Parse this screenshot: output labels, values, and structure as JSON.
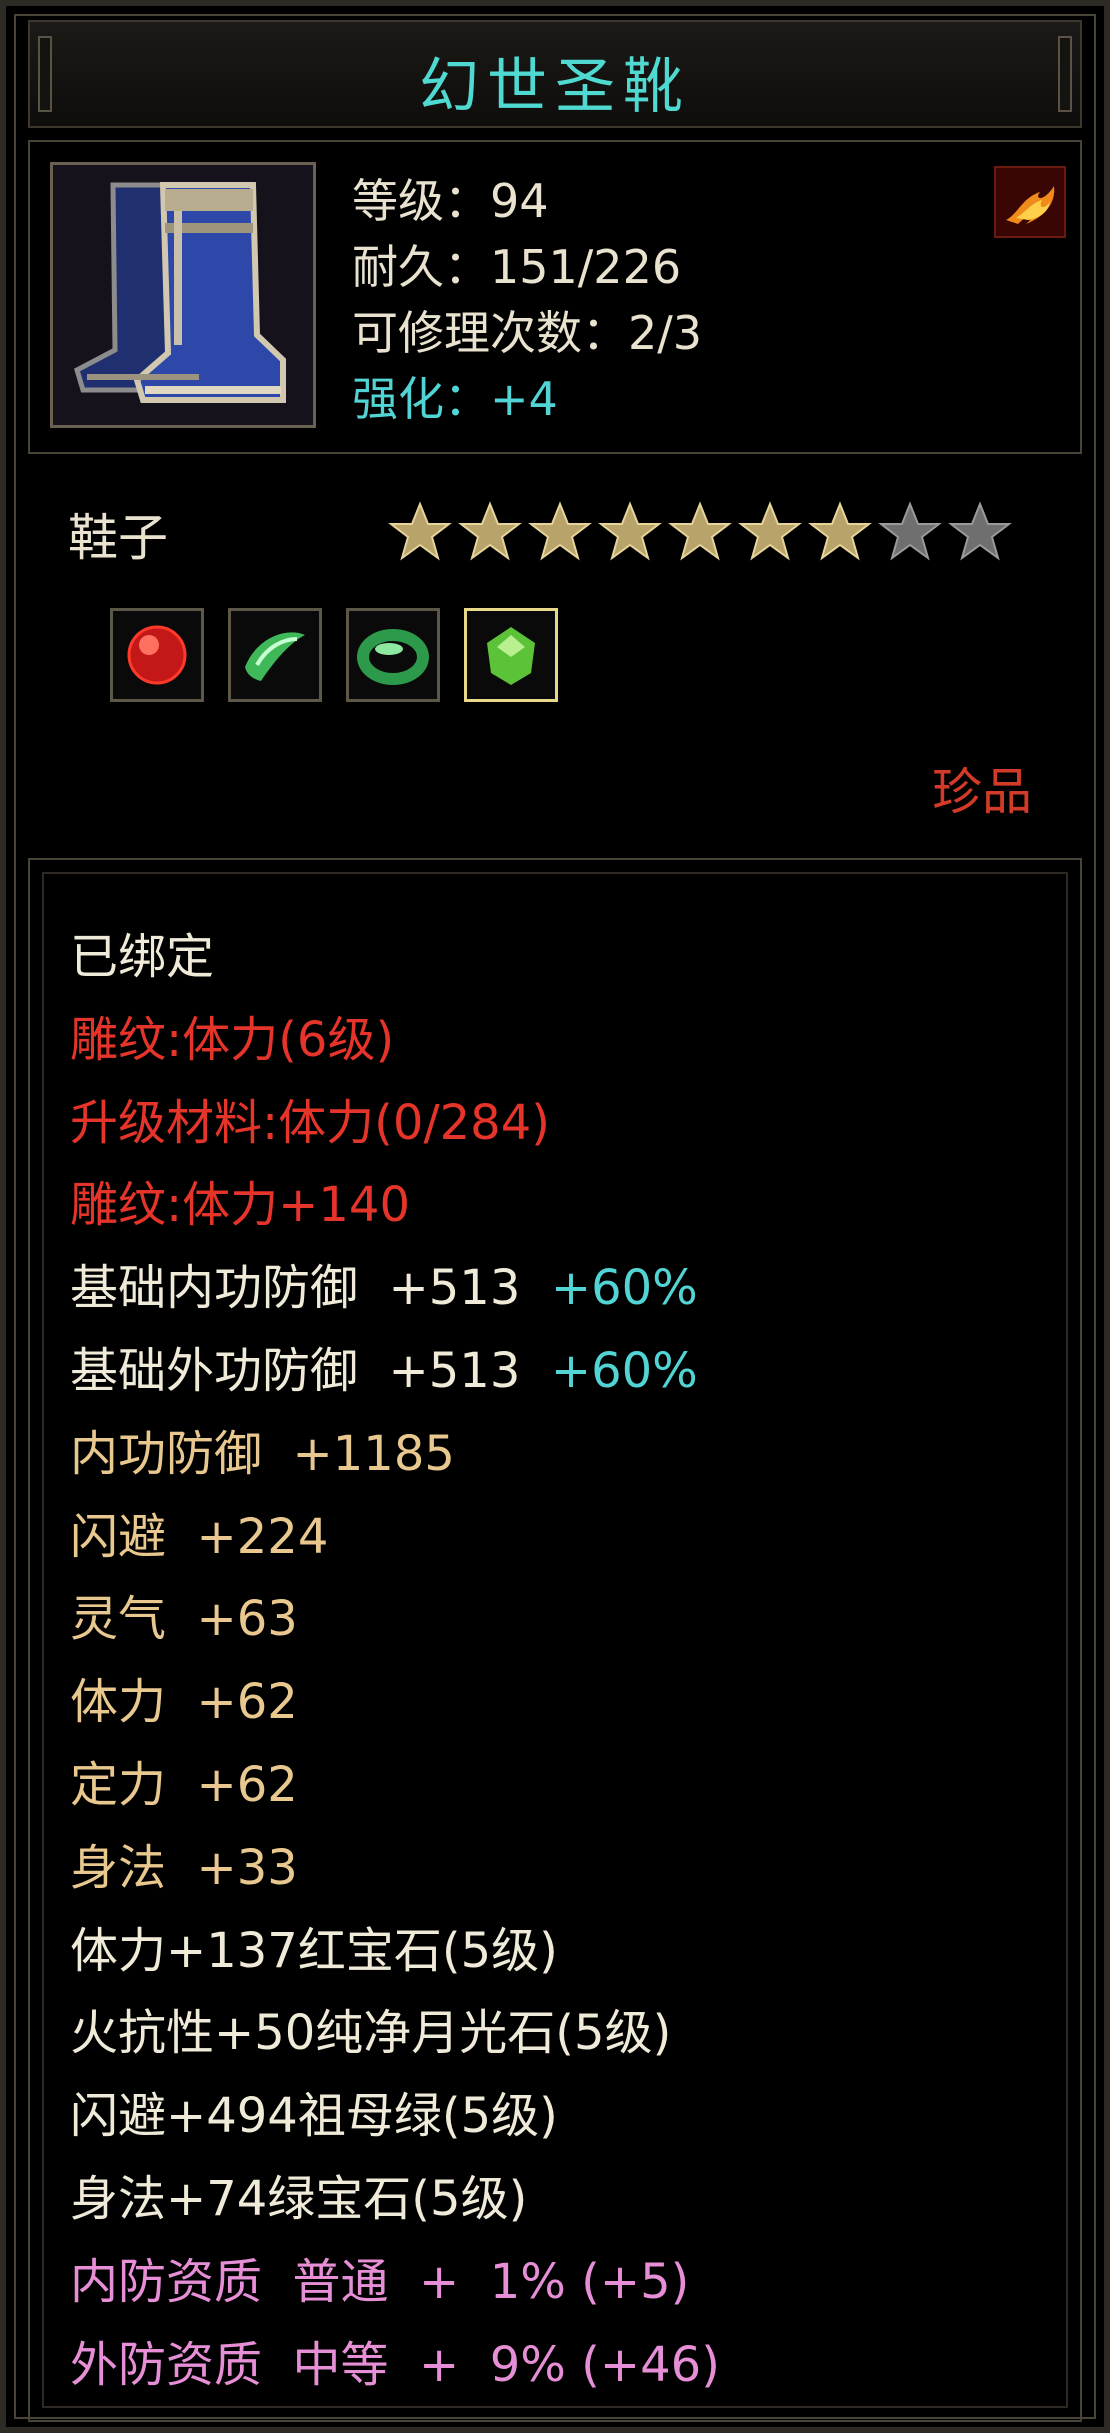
{
  "title": "幻世圣靴",
  "header": {
    "item_icon": "blue-boots-icon",
    "badge_icon": "fire-phoenix-icon",
    "level": "等级：94",
    "durability": "耐久：151/226",
    "repairs": "可修理次数：2/3",
    "enhance": "强化：+4"
  },
  "item_type": "鞋子",
  "stars": {
    "filled": 7,
    "total": 9
  },
  "gems": [
    {
      "icon": "ruby-gem-icon",
      "color": "#d82020"
    },
    {
      "icon": "moonstone-gem-icon",
      "color": "#48c860"
    },
    {
      "icon": "emerald-ring-gem-icon",
      "color": "#2f9a48"
    },
    {
      "icon": "green-gem-icon",
      "color": "#6fd040",
      "selected": true
    }
  ],
  "rarity": "珍品",
  "attributes": [
    {
      "label": "已绑定",
      "color": "white"
    },
    {
      "label": "雕纹:体力(6级)",
      "color": "red"
    },
    {
      "label": "升级材料:体力(0/284)",
      "color": "red"
    },
    {
      "label": "雕纹:体力+140",
      "color": "red"
    },
    {
      "label": "基础内功防御  +513  ",
      "extra": "+60%",
      "color": "white"
    },
    {
      "label": "基础外功防御  +513  ",
      "extra": "+60%",
      "color": "white"
    },
    {
      "label": "内功防御  +1185",
      "color": "gold"
    },
    {
      "label": "闪避  +224",
      "color": "gold"
    },
    {
      "label": "灵气  +63",
      "color": "gold"
    },
    {
      "label": "体力  +62",
      "color": "gold"
    },
    {
      "label": "定力  +62",
      "color": "gold"
    },
    {
      "label": "身法  +33",
      "color": "gold"
    },
    {
      "label": "体力+137红宝石(5级)",
      "color": "white"
    },
    {
      "label": "火抗性+50纯净月光石(5级)",
      "color": "white"
    },
    {
      "label": "闪避+494祖母绿(5级)",
      "color": "white"
    },
    {
      "label": "身法+74绿宝石(5级)",
      "color": "white"
    },
    {
      "label": "内防资质  普通  +  1% (+5)",
      "color": "pink"
    },
    {
      "label": "外防资质  中等  +  9% (+46)",
      "color": "pink"
    }
  ],
  "colors": {
    "title": "#4fd9d0",
    "red": "#e5342a",
    "gold": "#e8c88e",
    "pink": "#e68fd6",
    "cyan": "#52d4d4"
  }
}
